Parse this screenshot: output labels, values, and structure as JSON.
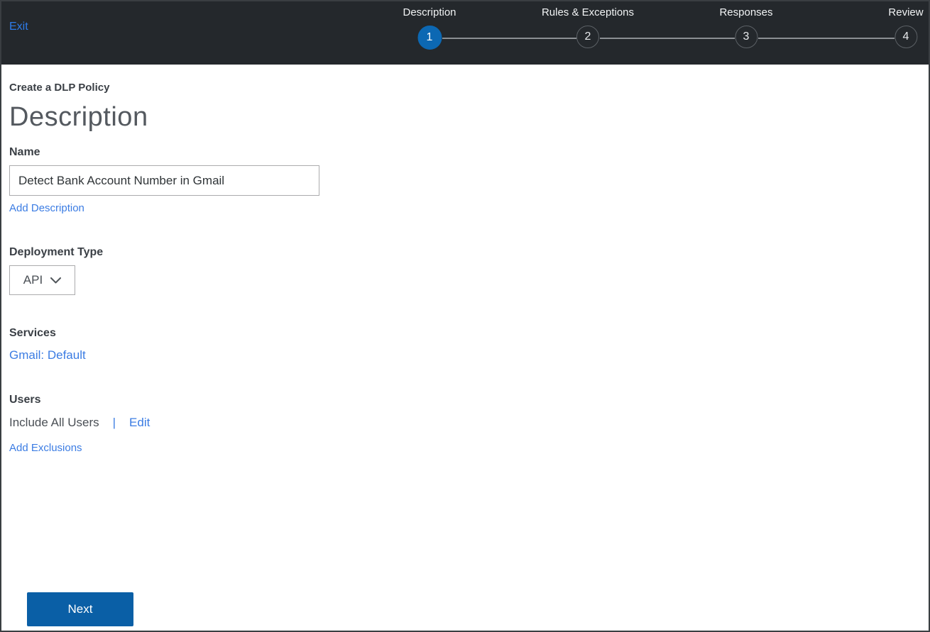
{
  "header": {
    "exit_label": "Exit",
    "steps": [
      {
        "label": "Description",
        "number": "1",
        "active": true
      },
      {
        "label": "Rules & Exceptions",
        "number": "2",
        "active": false
      },
      {
        "label": "Responses",
        "number": "3",
        "active": false
      },
      {
        "label": "Review",
        "number": "4",
        "active": false
      }
    ]
  },
  "main": {
    "eyebrow": "Create a DLP Policy",
    "title": "Description",
    "name_section": {
      "label": "Name",
      "value": "Detect Bank Account Number in Gmail",
      "add_description_label": "Add Description"
    },
    "deployment_section": {
      "label": "Deployment Type",
      "selected_option": "API"
    },
    "services_section": {
      "label": "Services",
      "service_link": "Gmail: Default"
    },
    "users_section": {
      "label": "Users",
      "value": "Include All Users",
      "separator": "|",
      "edit_label": "Edit",
      "add_exclusions_label": "Add Exclusions"
    },
    "next_button_label": "Next"
  },
  "colors": {
    "header_bg": "#24282c",
    "active_step_blue": "#0c68b3",
    "button_blue": "#0a5fa6",
    "link_blue": "#3b7ce3",
    "header_link_blue": "#2e7cea",
    "step_line_gray": "#8b8f93",
    "title_gray": "#54595f"
  },
  "icons": {
    "dropdown_chevron": "chevron-down-icon"
  }
}
